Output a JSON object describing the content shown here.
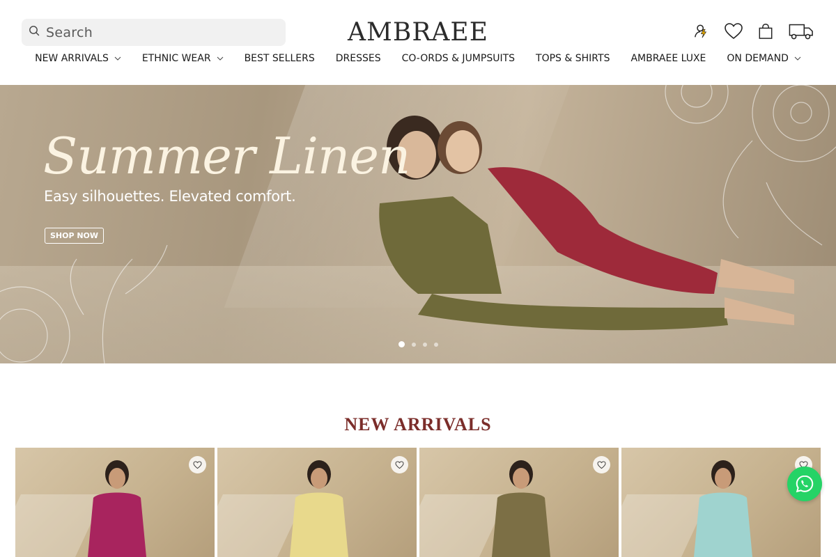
{
  "search": {
    "placeholder": "Search"
  },
  "brand": {
    "logo_text": "AMBRAEE"
  },
  "header_icons": [
    "account-icon",
    "wishlist-icon",
    "cart-icon",
    "delivery-truck-icon"
  ],
  "nav": {
    "items": [
      {
        "label": "NEW ARRIVALS",
        "has_dropdown": true
      },
      {
        "label": "ETHNIC WEAR",
        "has_dropdown": true
      },
      {
        "label": "BEST SELLERS",
        "has_dropdown": false
      },
      {
        "label": "DRESSES",
        "has_dropdown": false
      },
      {
        "label": "CO-ORDS & JUMPSUITS",
        "has_dropdown": false
      },
      {
        "label": "TOPS & SHIRTS",
        "has_dropdown": false
      },
      {
        "label": "AMBRAEE LUXE",
        "has_dropdown": false
      },
      {
        "label": "ON DEMAND",
        "has_dropdown": true
      }
    ]
  },
  "hero": {
    "title": "Summer Linen",
    "subtitle": "Easy silhouettes. Elevated comfort.",
    "cta": "SHOP NOW",
    "slides": 4,
    "active_slide": 1
  },
  "new_arrivals": {
    "title": "NEW ARRIVALS",
    "products": [
      {
        "outfit_color": "#a8245e"
      },
      {
        "outfit_color": "#e8d98c"
      },
      {
        "outfit_color": "#7c6f45"
      },
      {
        "outfit_color": "#9fd3cf"
      }
    ]
  },
  "colors": {
    "accent": "#7b2d2a",
    "whatsapp": "#25d366"
  }
}
